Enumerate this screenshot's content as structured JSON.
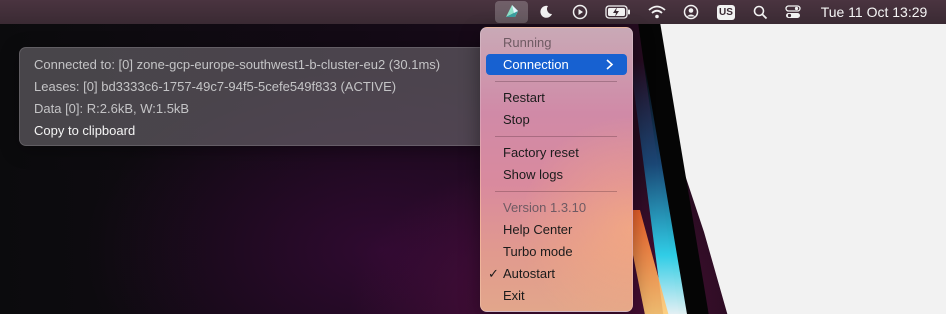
{
  "menubar": {
    "app_icon": "app-logo-icon",
    "icons": [
      "moon-icon",
      "play-circle-icon",
      "battery-charging-icon",
      "wifi-icon",
      "user-circle-icon",
      "input-source-icon",
      "search-icon",
      "control-center-icon"
    ],
    "input_source_label": "US",
    "clock": "Tue 11 Oct  13:29"
  },
  "connection_panel": {
    "line_connected": "Connected to: [0] zone-gcp-europe-southwest1-b-cluster-eu2 (30.1ms)",
    "line_leases": "Leases: [0] bd3333c6-1757-49c7-94f5-5cefe549f833 (ACTIVE)",
    "line_data": "Data [0]: R:2.6kB, W:1.5kB",
    "copy_label": "Copy to clipboard"
  },
  "menu": {
    "status": "Running",
    "connection": "Connection",
    "restart": "Restart",
    "stop": "Stop",
    "factory_reset": "Factory reset",
    "show_logs": "Show logs",
    "version": "Version 1.3.10",
    "help_center": "Help Center",
    "turbo_mode": "Turbo mode",
    "autostart": "Autostart",
    "autostart_checked": true,
    "exit": "Exit",
    "check_mark": "✓",
    "highlight_color": "#1761d1"
  }
}
